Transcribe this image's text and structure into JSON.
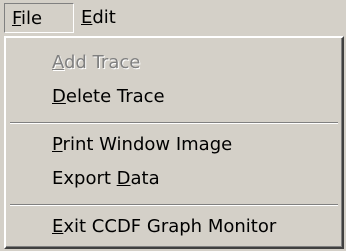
{
  "menubar": {
    "file": {
      "first": "F",
      "rest": "ile"
    },
    "edit": {
      "first": "E",
      "rest": "dit"
    }
  },
  "file_menu": {
    "add_trace": {
      "first": "A",
      "rest": "dd Trace",
      "enabled": false
    },
    "delete_trace": {
      "first": "D",
      "rest": "elete Trace"
    },
    "print_window_image": {
      "first": "P",
      "rest": "rint Window Image"
    },
    "export_data": {
      "before": "Export ",
      "mn": "D",
      "after": "ata"
    },
    "exit": {
      "first": "E",
      "rest": "xit CCDF Graph Monitor"
    }
  }
}
